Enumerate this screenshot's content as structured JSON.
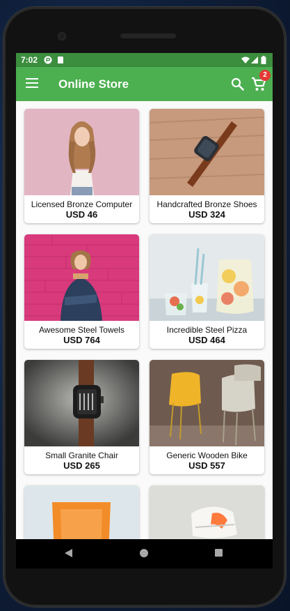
{
  "status_bar": {
    "time": "7:02"
  },
  "app_bar": {
    "title": "Online Store",
    "cart_badge": "2"
  },
  "products": [
    {
      "name": "Licensed Bronze Computer",
      "price": "USD 46"
    },
    {
      "name": "Handcrafted Bronze Shoes",
      "price": "USD 324"
    },
    {
      "name": "Awesome Steel Towels",
      "price": "USD 764"
    },
    {
      "name": "Incredible Steel Pizza",
      "price": "USD 464"
    },
    {
      "name": "Small Granite Chair",
      "price": "USD 265"
    },
    {
      "name": "Generic Wooden Bike",
      "price": "USD 557"
    }
  ],
  "icons": [
    "menu-icon",
    "search-icon",
    "cart-icon",
    "nav-back-icon",
    "nav-home-icon",
    "nav-recents-icon"
  ],
  "colors": {
    "app_bar": "#4caf50",
    "status_bar": "#3c8e3f",
    "badge": "#e53935"
  }
}
